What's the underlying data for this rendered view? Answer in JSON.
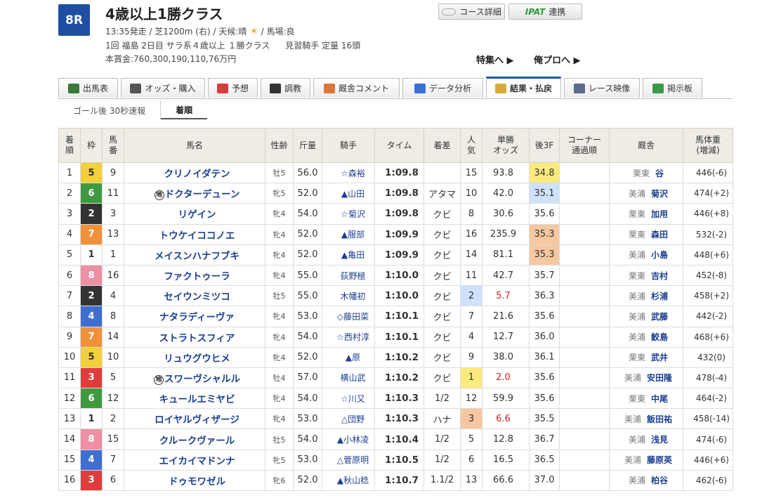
{
  "header": {
    "race_number": "8R",
    "title": "4歳以上1勝クラス",
    "line1_pre": "13:35発走 / 芝1200m (右) / 天候:晴",
    "line1_post": "/ 馬場:良",
    "line2_left": "1回 福島 2日目 サラ系４歳以上 １勝クラス",
    "line2_right": "見習騎手 定量 16頭",
    "line3": "本賞金:760,300,190,110,76万円",
    "course_button": "コース詳細",
    "ipat_label": "IPAT",
    "ipat_suffix": "連携",
    "link_tokushu": "特集へ ▶",
    "link_orepro": "俺プロへ ▶",
    "weather_icon": "sun-icon"
  },
  "tabs": [
    {
      "label": "出馬表",
      "icon": "table-icon",
      "color": "#3a7a3a"
    },
    {
      "label": "オッズ・購入",
      "icon": "chart-icon",
      "color": "#555555"
    },
    {
      "label": "予想",
      "icon": "target-icon",
      "color": "#d83b3b"
    },
    {
      "label": "調教",
      "icon": "stopwatch-icon",
      "color": "#333333"
    },
    {
      "label": "厩舎コメント",
      "icon": "person-icon",
      "color": "#d8783b"
    },
    {
      "label": "データ分析",
      "icon": "bar-chart-icon",
      "color": "#3b6fd8"
    },
    {
      "label": "結果・払戻",
      "icon": "coins-icon",
      "color": "#d8a93b"
    },
    {
      "label": "レース映像",
      "icon": "video-icon",
      "color": "#5b6b8b"
    },
    {
      "label": "掲示板",
      "icon": "chat-icon",
      "color": "#3a9a4a"
    }
  ],
  "subtabs": [
    {
      "label": "ゴール後 30秒速報"
    },
    {
      "label": "着順"
    }
  ],
  "table": {
    "headers": {
      "rank": "着\n順",
      "frame": "枠",
      "num": "馬\n番",
      "name": "馬名",
      "sexage": "性齢",
      "weight": "斤量",
      "jockey": "騎手",
      "time": "タイム",
      "margin": "着差",
      "pop": "人\n気",
      "odds": "単勝\nオッズ",
      "last3f": "後3F",
      "corner": "コーナー\n通過順",
      "stable": "厩舎",
      "body": "馬体重\n(増減)"
    },
    "rows": [
      {
        "rank": "1",
        "frame": "5",
        "num": "9",
        "mark": "",
        "name": "クリノイダテン",
        "sexage": "牡5",
        "weight": "56.0",
        "jockey": "☆森裕",
        "time": "1:09.8",
        "margin": "",
        "pop": "15",
        "odds": "93.8",
        "last3f": "34.8",
        "f3rank": 1,
        "region": "栗東",
        "trainer": "谷",
        "body": "446(-6)"
      },
      {
        "rank": "2",
        "frame": "6",
        "num": "11",
        "mark": "地",
        "name": "ドクターデューン",
        "sexage": "牝5",
        "weight": "52.0",
        "jockey": "▲山田",
        "time": "1:09.8",
        "margin": "アタマ",
        "pop": "10",
        "odds": "42.0",
        "last3f": "35.1",
        "f3rank": 2,
        "region": "美浦",
        "trainer": "菊沢",
        "body": "474(+2)"
      },
      {
        "rank": "3",
        "frame": "2",
        "num": "3",
        "mark": "",
        "name": "リゲイン",
        "sexage": "牝4",
        "weight": "54.0",
        "jockey": "☆菊沢",
        "time": "1:09.8",
        "margin": "クビ",
        "pop": "8",
        "odds": "30.6",
        "last3f": "35.6",
        "f3rank": 0,
        "region": "栗東",
        "trainer": "加用",
        "body": "446(+8)"
      },
      {
        "rank": "4",
        "frame": "7",
        "num": "13",
        "mark": "",
        "name": "トウケイココノエ",
        "sexage": "牝4",
        "weight": "52.0",
        "jockey": "▲服部",
        "time": "1:09.9",
        "margin": "クビ",
        "pop": "16",
        "odds": "235.9",
        "last3f": "35.3",
        "f3rank": 3,
        "region": "栗東",
        "trainer": "森田",
        "body": "532(-2)"
      },
      {
        "rank": "5",
        "frame": "1",
        "num": "1",
        "mark": "",
        "name": "メイスンハナフブキ",
        "sexage": "牝4",
        "weight": "52.0",
        "jockey": "▲亀田",
        "time": "1:09.9",
        "margin": "クビ",
        "pop": "14",
        "odds": "81.1",
        "last3f": "35.3",
        "f3rank": 3,
        "region": "美浦",
        "trainer": "小島",
        "body": "448(+6)"
      },
      {
        "rank": "6",
        "frame": "8",
        "num": "16",
        "mark": "",
        "name": "ファクトゥーラ",
        "sexage": "牝4",
        "weight": "55.0",
        "jockey": "荻野極",
        "time": "1:10.0",
        "margin": "クビ",
        "pop": "11",
        "odds": "42.7",
        "last3f": "35.7",
        "f3rank": 0,
        "region": "栗東",
        "trainer": "吉村",
        "body": "452(-8)"
      },
      {
        "rank": "7",
        "frame": "2",
        "num": "4",
        "mark": "",
        "name": "セイウンミツコ",
        "sexage": "牡5",
        "weight": "55.0",
        "jockey": "木幡初",
        "time": "1:10.0",
        "margin": "クビ",
        "pop": "2",
        "odds": "5.7",
        "last3f": "36.3",
        "f3rank": 0,
        "region": "美浦",
        "trainer": "杉浦",
        "body": "458(+2)"
      },
      {
        "rank": "8",
        "frame": "4",
        "num": "8",
        "mark": "",
        "name": "ナタラディーヴァ",
        "sexage": "牝4",
        "weight": "53.0",
        "jockey": "◇藤田菜",
        "time": "1:10.1",
        "margin": "クビ",
        "pop": "7",
        "odds": "21.6",
        "last3f": "35.6",
        "f3rank": 0,
        "region": "美浦",
        "trainer": "武藤",
        "body": "442(-2)"
      },
      {
        "rank": "9",
        "frame": "7",
        "num": "14",
        "mark": "",
        "name": "ストラトスフィア",
        "sexage": "牝4",
        "weight": "54.0",
        "jockey": "☆西村淳",
        "time": "1:10.1",
        "margin": "クビ",
        "pop": "4",
        "odds": "12.7",
        "last3f": "36.0",
        "f3rank": 0,
        "region": "美浦",
        "trainer": "鮫島",
        "body": "468(+6)"
      },
      {
        "rank": "10",
        "frame": "5",
        "num": "10",
        "mark": "",
        "name": "リュウグウヒメ",
        "sexage": "牝4",
        "weight": "52.0",
        "jockey": "▲原",
        "time": "1:10.2",
        "margin": "クビ",
        "pop": "9",
        "odds": "38.0",
        "last3f": "36.1",
        "f3rank": 0,
        "region": "栗東",
        "trainer": "武井",
        "body": "432(0)"
      },
      {
        "rank": "11",
        "frame": "3",
        "num": "5",
        "mark": "地",
        "name": "スワーヴシャルル",
        "sexage": "牡4",
        "weight": "57.0",
        "jockey": "横山武",
        "time": "1:10.2",
        "margin": "クビ",
        "pop": "1",
        "odds": "2.0",
        "last3f": "35.6",
        "f3rank": 0,
        "region": "美浦",
        "trainer": "安田隆",
        "body": "478(-4)"
      },
      {
        "rank": "12",
        "frame": "6",
        "num": "12",
        "mark": "",
        "name": "キュールエミヤビ",
        "sexage": "牝4",
        "weight": "54.0",
        "jockey": "☆川又",
        "time": "1:10.3",
        "margin": "1/2",
        "pop": "12",
        "odds": "59.9",
        "last3f": "35.6",
        "f3rank": 0,
        "region": "栗東",
        "trainer": "中尾",
        "body": "464(-2)"
      },
      {
        "rank": "13",
        "frame": "1",
        "num": "2",
        "mark": "",
        "name": "ロイヤルヴィザージ",
        "sexage": "牝4",
        "weight": "53.0",
        "jockey": "△団野",
        "time": "1:10.3",
        "margin": "ハナ",
        "pop": "3",
        "odds": "6.6",
        "last3f": "35.5",
        "f3rank": 0,
        "region": "美浦",
        "trainer": "飯田祐",
        "body": "458(-14)"
      },
      {
        "rank": "14",
        "frame": "8",
        "num": "15",
        "mark": "",
        "name": "クルークヴァール",
        "sexage": "牡5",
        "weight": "54.0",
        "jockey": "▲小林凌",
        "time": "1:10.4",
        "margin": "1/2",
        "pop": "5",
        "odds": "12.8",
        "last3f": "36.7",
        "f3rank": 0,
        "region": "美浦",
        "trainer": "浅見",
        "body": "474(-6)"
      },
      {
        "rank": "15",
        "frame": "4",
        "num": "7",
        "mark": "",
        "name": "エイカイマドンナ",
        "sexage": "牝5",
        "weight": "53.0",
        "jockey": "△菅原明",
        "time": "1:10.5",
        "margin": "1/2",
        "pop": "6",
        "odds": "16.5",
        "last3f": "36.5",
        "f3rank": 0,
        "region": "美浦",
        "trainer": "藤原英",
        "body": "446(+6)"
      },
      {
        "rank": "16",
        "frame": "3",
        "num": "6",
        "mark": "",
        "name": "ドゥモワゼル",
        "sexage": "牝6",
        "weight": "52.0",
        "jockey": "▲秋山稔",
        "time": "1:10.7",
        "margin": "1.1/2",
        "pop": "13",
        "odds": "66.6",
        "last3f": "37.0",
        "f3rank": 0,
        "region": "美浦",
        "trainer": "柏谷",
        "body": "462(-6)"
      }
    ]
  },
  "frame_colors": {
    "1": {
      "bg": "#ffffff",
      "fg": "#333333"
    },
    "2": {
      "bg": "#333333",
      "fg": "#ffffff"
    },
    "3": {
      "bg": "#e03c3c",
      "fg": "#ffffff"
    },
    "4": {
      "bg": "#3e6fd0",
      "fg": "#ffffff"
    },
    "5": {
      "bg": "#f2cf3b",
      "fg": "#333333"
    },
    "6": {
      "bg": "#3f9a3f",
      "fg": "#ffffff"
    },
    "7": {
      "bg": "#f0913a",
      "fg": "#ffffff"
    },
    "8": {
      "bg": "#ee8fa6",
      "fg": "#ffffff"
    }
  },
  "colors": {
    "accent": "#1e5aad",
    "badge": "#1e4fa0",
    "link": "#1b3f8f",
    "hot_odds": "#cc2222"
  }
}
